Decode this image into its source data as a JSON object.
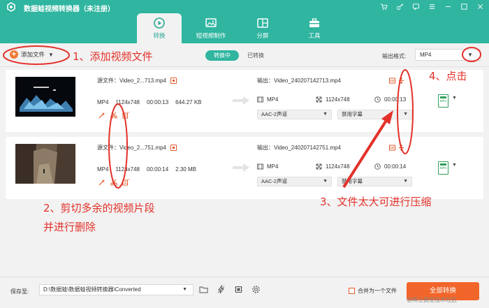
{
  "app": {
    "title": "数据蛙视频转换器（未注册）"
  },
  "tabs": [
    {
      "label": "转换",
      "active": true
    },
    {
      "label": "短视频制作",
      "active": false
    },
    {
      "label": "分屏",
      "active": false
    },
    {
      "label": "工具",
      "active": false
    }
  ],
  "toolbar": {
    "add_file": "添加文件",
    "segments": [
      "转换中",
      "已转换"
    ],
    "output_format_label": "输出格式:",
    "output_format_value": "MP4"
  },
  "files": [
    {
      "source_name": "源文件：Video_2...713.mp4",
      "format": "MP4",
      "resolution": "1124x748",
      "duration": "00:00:13",
      "size": "644.27 KB",
      "output_name": "输出：Video_240207142713.mp4",
      "out_format": "MP4",
      "out_resolution": "1124x748",
      "out_duration": "00:00:13",
      "audio": "AAC-2声道",
      "subtitle": "禁用字幕",
      "badge": "MP4"
    },
    {
      "source_name": "源文件：Video_2...751.mp4",
      "format": "MP4",
      "resolution": "1124x748",
      "duration": "00:00:14",
      "size": "2.30 MB",
      "output_name": "输出：Video_240207142751.mp4",
      "out_format": "MP4",
      "out_resolution": "1124x748",
      "out_duration": "00:00:14",
      "audio": "AAC-2声道",
      "subtitle": "禁用字幕",
      "badge": "MP4"
    }
  ],
  "annotations": {
    "step1": "1、添加视频文件",
    "step2_line1": "2、剪切多余的视频片段",
    "step2_line2": "并进行删除",
    "step3": "3、文件太大可进行压缩",
    "step4": "4、点击"
  },
  "footer": {
    "save_label": "保存至:",
    "save_path": "D:\\数据蛙\\数据蛙视频转换器\\Converted",
    "merge_label": "合并为一个文件",
    "convert_all": "全部转换"
  },
  "watermark": "@稀土掘金技术社区",
  "colors": {
    "header": "#2fb5a0",
    "accent_orange": "#f2652a",
    "annotation_red": "#e3312a"
  }
}
